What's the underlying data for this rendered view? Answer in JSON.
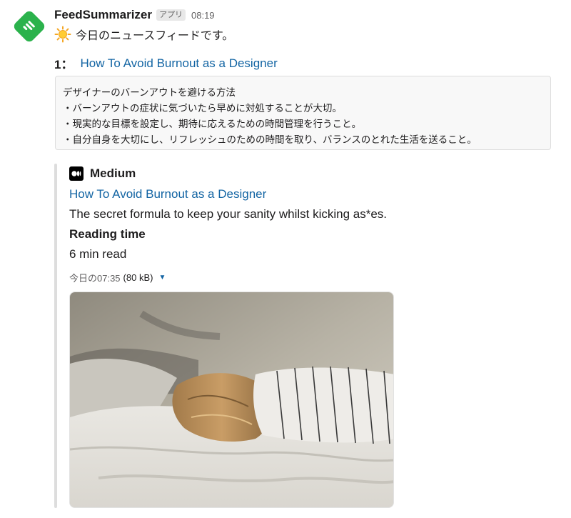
{
  "message": {
    "app_name": "FeedSummarizer",
    "app_badge": "アプリ",
    "time": "08:19",
    "intro_emoji": "sun-icon",
    "intro_text": "今日のニュースフィードです。"
  },
  "item": {
    "number": "1：",
    "title": "How To Avoid Burnout as a Designer",
    "summary_lines": [
      "デザイナーのバーンアウトを避ける方法",
      "・バーンアウトの症状に気づいたら早めに対処することが大切。",
      "・現実的な目標を設定し、期待に応えるための時間管理を行うこと。",
      "・自分自身を大切にし、リフレッシュのための時間を取り、バランスのとれた生活を送ること。"
    ]
  },
  "attachment": {
    "source": "Medium",
    "title": "How To Avoid Burnout as a Designer",
    "description": "The secret formula to keep your sanity whilst kicking as*es.",
    "field_label": "Reading time",
    "field_value": "6 min read",
    "meta_time": "今日の07:35",
    "meta_size": "(80 kB)",
    "image_alt": "person lying on bed"
  },
  "colors": {
    "link": "#1264a3",
    "feedly_green": "#2bb24c",
    "summary_bg": "#f8f8f8",
    "attachment_bar": "#dddddd"
  }
}
